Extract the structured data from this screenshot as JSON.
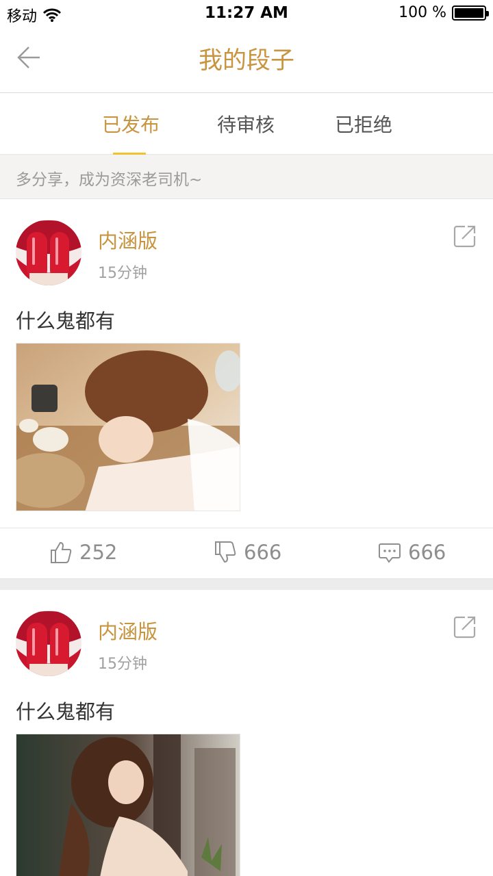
{
  "status_bar": {
    "carrier": "移动",
    "time": "11:27 AM",
    "battery_text": "100 %",
    "battery_level": 1.0
  },
  "nav": {
    "title": "我的段子",
    "back_icon": "arrow-left-icon"
  },
  "tabs": [
    {
      "label": "已发布",
      "active": true
    },
    {
      "label": "待审核",
      "active": false
    },
    {
      "label": "已拒绝",
      "active": false
    }
  ],
  "notice": {
    "text": "多分享，成为资深老司机~"
  },
  "posts": [
    {
      "username": "内涵版",
      "time": "15分钟",
      "text": "什么鬼都有",
      "likes": "252",
      "dislikes": "666",
      "comments": "666"
    },
    {
      "username": "内涵版",
      "time": "15分钟",
      "text": "什么鬼都有"
    }
  ],
  "colors": {
    "accent": "#c9943f",
    "tab_indicator": "#f2c12e",
    "notice_bg": "#f4f3f1"
  }
}
